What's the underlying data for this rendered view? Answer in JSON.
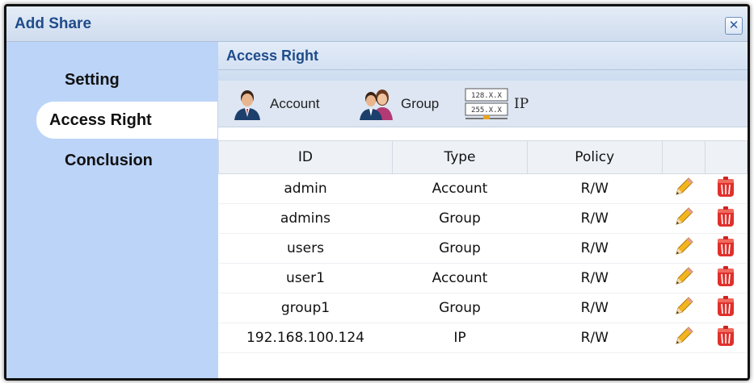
{
  "window": {
    "title": "Add Share",
    "close_glyph": "✕"
  },
  "sidebar": {
    "items": [
      {
        "label": "Setting",
        "active": false
      },
      {
        "label": "Access Right",
        "active": true
      },
      {
        "label": "Conclusion",
        "active": false
      }
    ]
  },
  "section": {
    "title": "Access Right"
  },
  "toolbar": {
    "account_label": "Account",
    "group_label": "Group",
    "ip_label": "IP",
    "ip_icon_line1": "128.X.X",
    "ip_icon_line2": "255.X.X"
  },
  "table": {
    "headers": {
      "id": "ID",
      "type": "Type",
      "policy": "Policy"
    },
    "rows": [
      {
        "id": "admin",
        "type": "Account",
        "policy": "R/W"
      },
      {
        "id": "admins",
        "type": "Group",
        "policy": "R/W"
      },
      {
        "id": "users",
        "type": "Group",
        "policy": "R/W"
      },
      {
        "id": "user1",
        "type": "Account",
        "policy": "R/W"
      },
      {
        "id": "group1",
        "type": "Group",
        "policy": "R/W"
      },
      {
        "id": "192.168.100.124",
        "type": "IP",
        "policy": "R/W"
      }
    ]
  },
  "icons": {
    "edit": "pencil-icon",
    "delete": "trash-icon"
  },
  "colors": {
    "title": "#1f4c8a",
    "sidebar": "#bcd4f8",
    "delete": "#e0302c",
    "pencil": "#f2b51f"
  }
}
